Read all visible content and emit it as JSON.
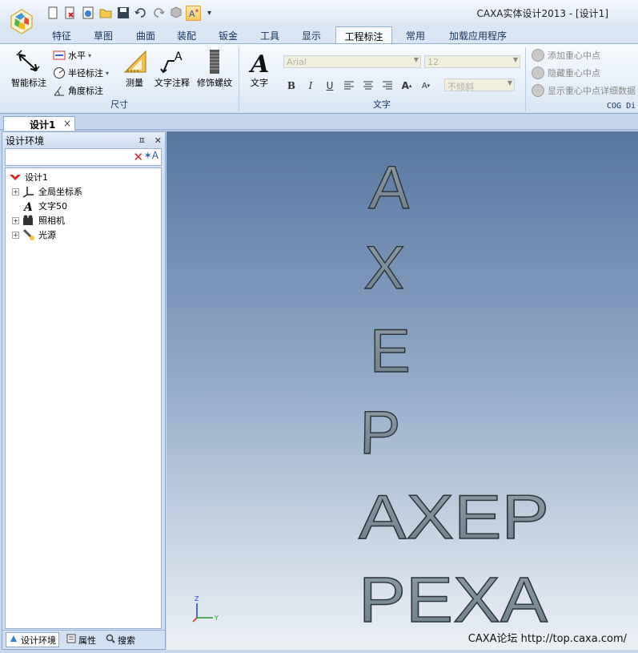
{
  "window": {
    "title": "CAXA实体设计2013 - [设计1]"
  },
  "quick_access": {
    "overflow": "▾"
  },
  "ribbon_tabs": [
    "特征",
    "草图",
    "曲面",
    "装配",
    "钣金",
    "工具",
    "显示",
    "工程标注",
    "常用",
    "加载应用程序"
  ],
  "active_tab": "工程标注",
  "ribbon": {
    "dim_group": {
      "label": "尺寸",
      "smart_dim": "智能标注",
      "horizontal": "水平",
      "radius": "半径标注",
      "angle": "角度标注",
      "measure": "测量",
      "text_leader": "文字注释",
      "thread": "修饰螺纹"
    },
    "text_group": {
      "label": "文字",
      "text_button": "文字",
      "font_value": "Arial",
      "size_value": "12",
      "slant_value": "不倾斜"
    },
    "cog_group": {
      "label": "COG Di",
      "add_cog": "添加重心中点",
      "hide_cog": "隐藏重心中点",
      "show_cog_detail": "显示重心中点详细数据"
    }
  },
  "doc_tab": {
    "label": "设计1",
    "close": "×"
  },
  "panel": {
    "title": "设计环境",
    "pin": "ㅍ",
    "close": "✕",
    "tree": [
      {
        "label": "设计1"
      },
      {
        "label": "全局坐标系"
      },
      {
        "label": "文字50"
      },
      {
        "label": "照相机"
      },
      {
        "label": "光源"
      }
    ],
    "tabs": [
      "设计环境",
      "属性",
      "搜索"
    ]
  },
  "scene": {
    "texts": [
      "A",
      "X",
      "E",
      "P",
      "AXEP",
      "PEXA"
    ],
    "triad_labels": {
      "z": "Z",
      "y": "Y"
    },
    "watermark": "CAXA论坛 http://top.caxa.com/"
  }
}
